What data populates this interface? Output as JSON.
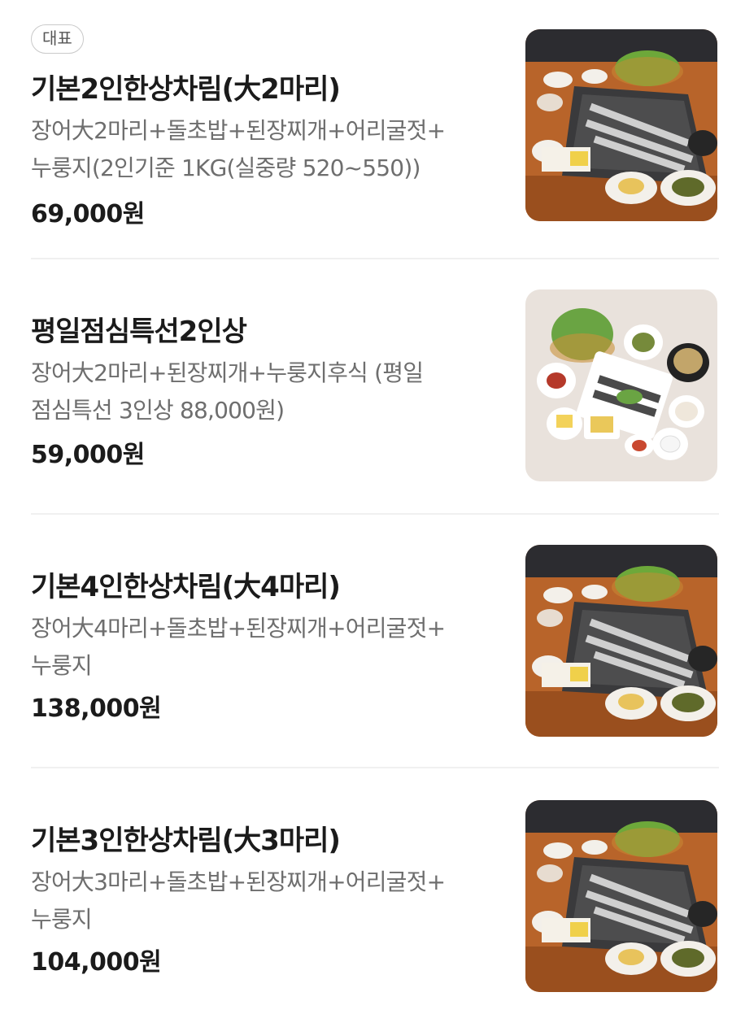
{
  "menu": {
    "items": [
      {
        "badge": "대표",
        "title": "기본2인한상차림(大2마리)",
        "desc_line1": "장어大2마리+돌초밥+된장찌개+어리굴젓+",
        "desc_line2": "누룽지(2인기준 1KG(실중량 520~550))",
        "price": "69,000원"
      },
      {
        "title": "평일점심특선2인상",
        "desc_line1": "장어大2마리+된장찌개+누룽지후식 (평일",
        "desc_line2": "점심특선 3인상 88,000원)",
        "price": "59,000원"
      },
      {
        "title": "기본4인한상차림(大4마리)",
        "desc_line1": "장어大4마리+돌초밥+된장찌개+어리굴젓+",
        "desc_line2": "누룽지",
        "price": "138,000원"
      },
      {
        "title": "기본3인한상차림(大3마리)",
        "desc_line1": "장어大3마리+돌초밥+된장찌개+어리굴젓+",
        "desc_line2": "누룽지",
        "price": "104,000원"
      }
    ]
  }
}
